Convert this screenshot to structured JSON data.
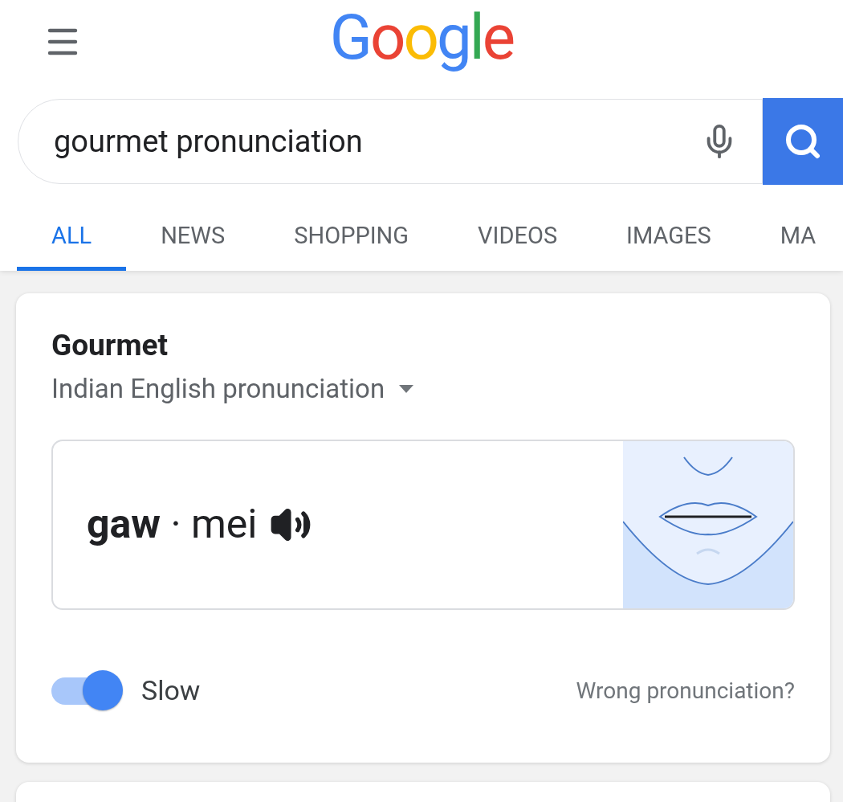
{
  "header": {
    "logo": "Google"
  },
  "search": {
    "value": "gourmet pronunciation"
  },
  "tabs": [
    {
      "label": "ALL",
      "selected": true
    },
    {
      "label": "NEWS",
      "selected": false
    },
    {
      "label": "SHOPPING",
      "selected": false
    },
    {
      "label": "VIDEOS",
      "selected": false
    },
    {
      "label": "IMAGES",
      "selected": false
    },
    {
      "label": "MA",
      "selected": false
    }
  ],
  "card": {
    "title": "Gourmet",
    "accent": "Indian English pronunciation",
    "phonetic": "**gaw** · mei",
    "slow": {
      "label": "Slow",
      "on": true
    },
    "feedback_link": "Wrong pronunciation?"
  }
}
